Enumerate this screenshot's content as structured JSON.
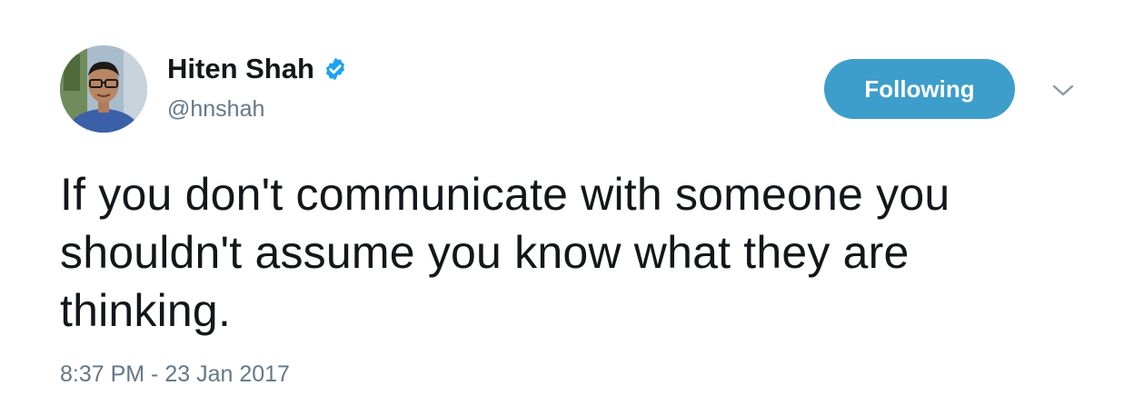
{
  "author": {
    "display_name": "Hiten Shah",
    "handle": "@hnshah",
    "verified": true,
    "avatar_icon": "profile-photo"
  },
  "follow_button": {
    "label": "Following",
    "color": "#3d9ecb"
  },
  "menu": {
    "icon": "chevron-down-icon"
  },
  "tweet": {
    "text": "If you don't communicate with someone you shouldn't assume you know what they are thinking.",
    "timestamp": "8:37 PM - 23 Jan 2017"
  },
  "colors": {
    "text": "#14171a",
    "secondary": "#657786",
    "verified": "#1da1f2"
  }
}
